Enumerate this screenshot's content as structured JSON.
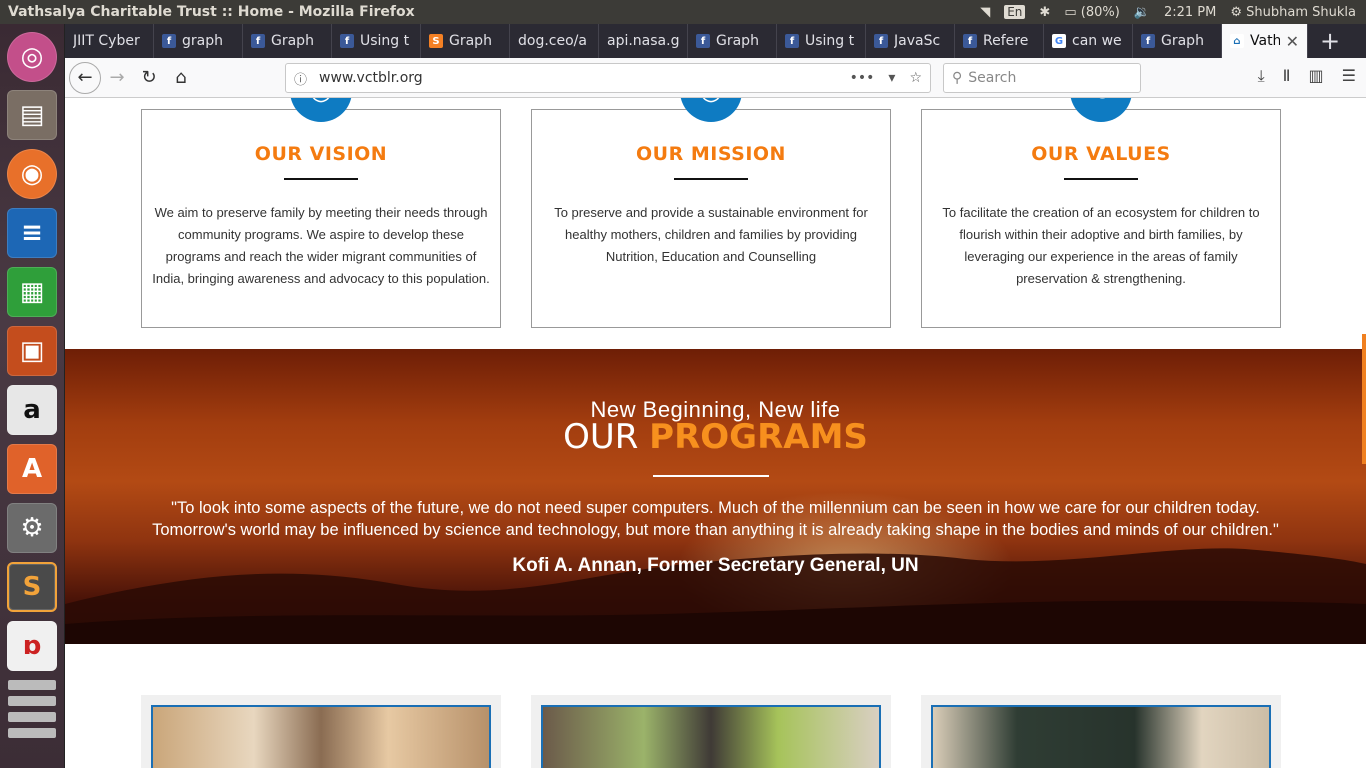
{
  "system": {
    "window_title": "Vathsalya Charitable Trust :: Home - Mozilla Firefox",
    "keyboard": "En",
    "battery": "(80%)",
    "time": "2:21 PM",
    "user": "Shubham Shukla"
  },
  "launcher": [
    "ubuntu-icon",
    "files-icon",
    "firefox-icon",
    "writer-icon",
    "calc-icon",
    "impress-icon",
    "amazon-icon",
    "software-center-icon",
    "settings-icon",
    "sublime-icon",
    "pdf-icon"
  ],
  "tabs": [
    {
      "label": "JIIT Cyber",
      "icon": "none"
    },
    {
      "label": "graph",
      "icon": "facebook"
    },
    {
      "label": "Graph",
      "icon": "facebook"
    },
    {
      "label": "Using t",
      "icon": "facebook"
    },
    {
      "label": "Graph",
      "icon": "stackoverflow"
    },
    {
      "label": "dog.ceo/a",
      "icon": "none"
    },
    {
      "label": "api.nasa.g",
      "icon": "none"
    },
    {
      "label": "Graph",
      "icon": "facebook"
    },
    {
      "label": "Using t",
      "icon": "facebook"
    },
    {
      "label": "JavaSc",
      "icon": "facebook"
    },
    {
      "label": "Refere",
      "icon": "facebook"
    },
    {
      "label": "can we",
      "icon": "google"
    },
    {
      "label": "Graph",
      "icon": "facebook"
    },
    {
      "label": "Vath",
      "icon": "vathsalya"
    }
  ],
  "nav": {
    "url": "www.vctblr.org",
    "search_placeholder": "Search",
    "page_actions": "•••"
  },
  "cards": [
    {
      "title": "OUR VISION",
      "text": "We aim to preserve family by meeting their needs through community programs. We aspire to develop these programs and reach the wider migrant communities of India, bringing awareness and advocacy to this population.",
      "icon": "target-icon"
    },
    {
      "title": "OUR MISSION",
      "text": "To preserve and provide a sustainable environment for healthy mothers, children and families by providing Nutrition, Education and Counselling",
      "icon": "target-icon"
    },
    {
      "title": "OUR VALUES",
      "text": "To facilitate the creation of an ecosystem for children to flourish within their adoptive and birth families, by leveraging our experience in the areas of family preservation & strengthening.",
      "icon": "handshake-icon"
    }
  ],
  "programs": {
    "subtitle": "New Beginning, New life",
    "heading_plain": "OUR",
    "heading_bold": "PROGRAMS",
    "quote_line1": "\"To look into some aspects of the future, we do not need super computers. Much of the millennium can be seen in how we care for our children today.",
    "quote_line2": "Tomorrow's world may be influenced by science and technology, but more than anything it is already taking shape in the bodies and minds of our children.\"",
    "author": "Kofi A. Annan, Former Secretary General, UN"
  },
  "colors": {
    "accent": "#f47b10",
    "icon_blue": "#0e7bc2"
  }
}
